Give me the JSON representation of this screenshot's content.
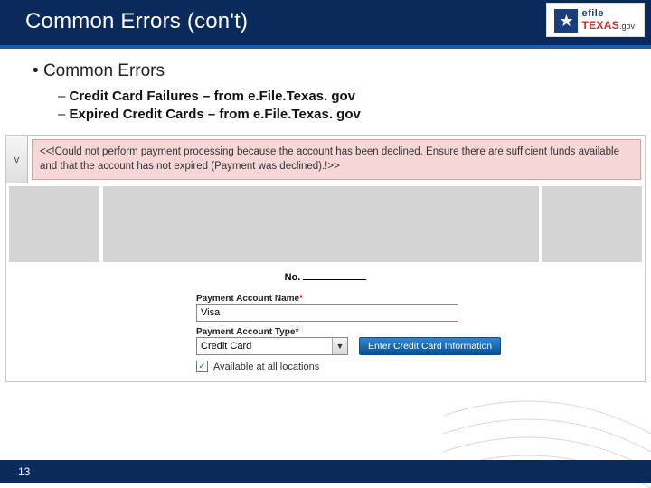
{
  "title": "Common Errors (con't)",
  "brand": {
    "top": "efile",
    "mid": "TEXAS",
    "bot": ".gov"
  },
  "bullets": {
    "main": "Common Errors",
    "sub1": "Credit Card Failures – from e.File.Texas. gov",
    "sub2": "Expired Credit Cards – from e.File.Texas. gov"
  },
  "screenshot": {
    "toggle": "v",
    "error_msg": "<<!Could not perform payment processing because the account has been declined.  Ensure there are sufficient funds available and that the account has not expired (Payment was declined).!>>",
    "doc_no_label": "No.",
    "form": {
      "acct_name_label": "Payment Account Name",
      "acct_name_value": "Visa",
      "acct_type_label": "Payment Account Type",
      "acct_type_value": "Credit Card",
      "enter_cc_btn": "Enter Credit Card Information",
      "checkbox_label": "Available at all locations",
      "checkbox_checked": "✓"
    }
  },
  "footer": {
    "page": "13"
  }
}
